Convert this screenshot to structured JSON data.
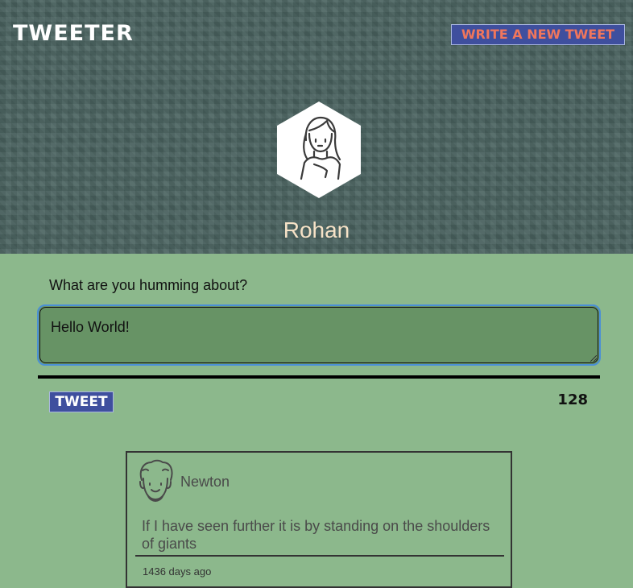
{
  "header": {
    "brand": "TWEETER",
    "write_button": "WRITE A NEW TWEET",
    "avatar_icon": "woman-avatar-icon",
    "username": "Rohan"
  },
  "compose": {
    "prompt": "What are you humming about?",
    "value": "Hello World!",
    "tweet_button": "TWEET",
    "counter": "128"
  },
  "tweets": [
    {
      "author": "Newton",
      "avatar_icon": "man-avatar-icon",
      "text": "If I have seen further it is by standing on the shoulders of giants",
      "time": "1436 days ago"
    }
  ],
  "colors": {
    "header_bg": "#4a6360",
    "page_bg": "#8cb88c",
    "button_bg": "#3f4f9e",
    "write_button_text": "#f0765c",
    "username": "#f6e2c7",
    "textarea_bg": "#679365",
    "focus_ring": "#4a8fd6"
  }
}
